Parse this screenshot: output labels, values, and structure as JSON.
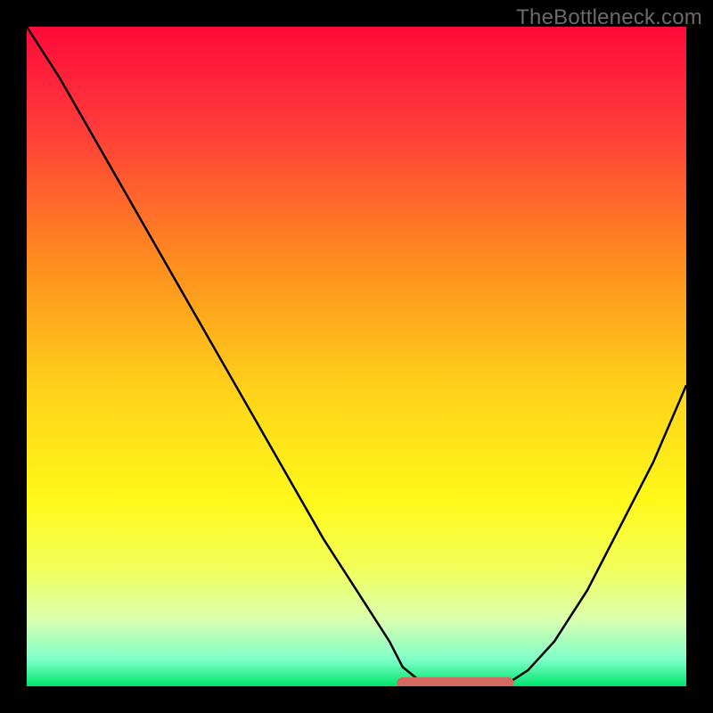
{
  "watermark": "TheBottleneck.com",
  "chart_data": {
    "type": "line",
    "title": "",
    "xlabel": "",
    "ylabel": "",
    "xlim": [
      0,
      100
    ],
    "ylim": [
      0,
      103
    ],
    "series": [
      {
        "name": "curve",
        "x": [
          0,
          5,
          10,
          15,
          20,
          25,
          30,
          35,
          40,
          45,
          50,
          55,
          57,
          60,
          63,
          70,
          73,
          76,
          80,
          85,
          90,
          95,
          100
        ],
        "y": [
          103,
          95,
          86,
          77,
          68,
          59,
          50,
          41,
          32,
          23,
          15,
          7,
          3,
          0.5,
          0,
          0,
          0.5,
          2.5,
          7,
          15,
          25,
          35,
          47
        ]
      }
    ],
    "sweet_spot": {
      "x0": 57,
      "x1": 73,
      "y": 0.5
    },
    "gradient_stops": [
      {
        "pct": 0,
        "color": "#ff0a3a"
      },
      {
        "pct": 15,
        "color": "#ff3a3a"
      },
      {
        "pct": 35,
        "color": "#ff8a1f"
      },
      {
        "pct": 55,
        "color": "#ffd21a"
      },
      {
        "pct": 72,
        "color": "#fff91a"
      },
      {
        "pct": 82,
        "color": "#f2ff5a"
      },
      {
        "pct": 90,
        "color": "#d9ffb0"
      },
      {
        "pct": 96,
        "color": "#7dffc8"
      },
      {
        "pct": 100,
        "color": "#00e56b"
      }
    ],
    "sweet_spot_color": "#d46a5f",
    "curve_color": "#000000"
  }
}
